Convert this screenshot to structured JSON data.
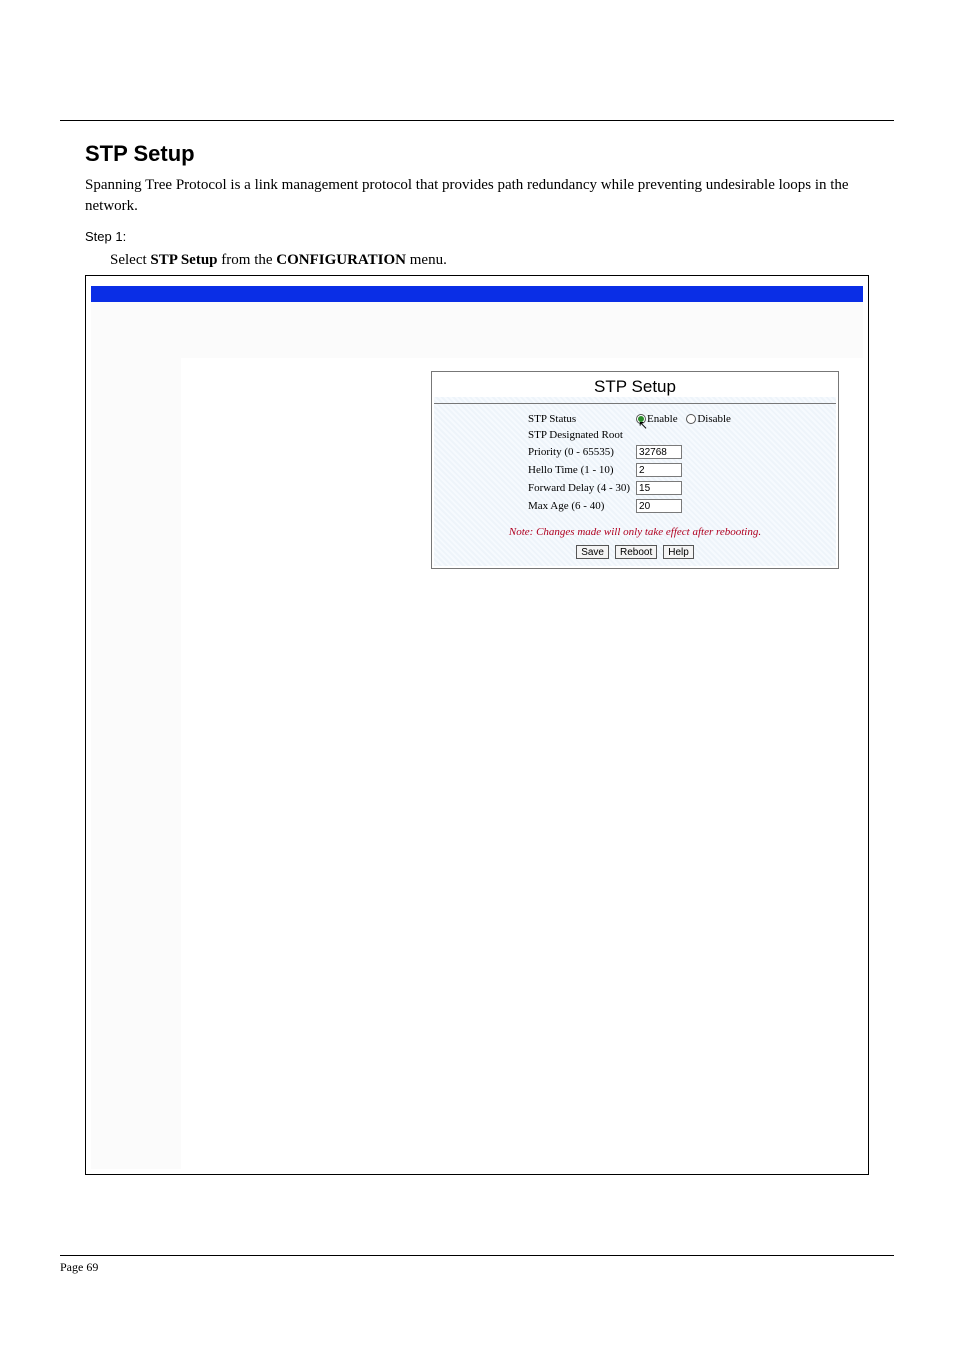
{
  "header": {
    "title": "STP Setup",
    "body": "Spanning Tree Protocol is a link management protocol that provides path redundancy while preventing undesirable loops in the network.",
    "step_label": "Step 1:",
    "step_line1_prefix": "Select ",
    "step_line1_bold": "STP Setup",
    "step_line1_suffix": " from the ",
    "step_line1_bold2": "CONFIGURATION",
    "step_line1_end": " menu."
  },
  "panel": {
    "title": "STP Setup",
    "rows": {
      "status_label": "STP Status",
      "radio_enable": "Enable",
      "radio_disable": "Disable",
      "designated_label": "STP Designated Root",
      "designated_value": "",
      "priority_label": "Priority (0 - 65535)",
      "priority_value": "32768",
      "hello_label": "Hello Time (1 - 10)",
      "hello_value": "2",
      "fwd_label": "Forward Delay (4 - 30)",
      "fwd_value": "15",
      "maxage_label": "Max Age (6 - 40)",
      "maxage_value": "20"
    },
    "note": "Note: Changes made will only take effect after rebooting.",
    "buttons": {
      "save": "Save",
      "reboot": "Reboot",
      "help": "Help"
    }
  },
  "footer": {
    "page": "Page 69",
    "right": ""
  }
}
